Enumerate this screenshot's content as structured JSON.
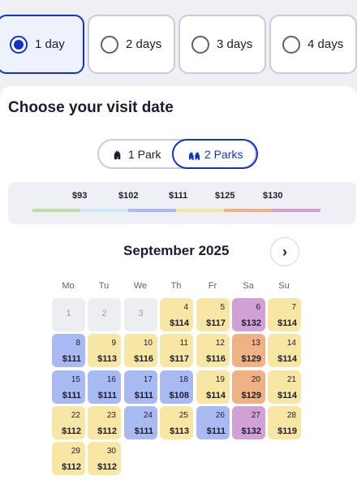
{
  "durations": [
    {
      "label": "1 day",
      "selected": true
    },
    {
      "label": "2 days",
      "selected": false
    },
    {
      "label": "3 days",
      "selected": false
    },
    {
      "label": "4 days",
      "selected": false
    }
  ],
  "section_title": "Choose your visit date",
  "park_toggle": [
    {
      "label": "1 Park",
      "selected": false,
      "icon": "castle-icon"
    },
    {
      "label": "2 Parks",
      "selected": true,
      "icon": "castles-icon"
    }
  ],
  "legend": [
    {
      "price": "$93",
      "color": "#b9e0a4"
    },
    {
      "price": "$102",
      "color": "#c9e9f6"
    },
    {
      "price": "$111",
      "color": "#a9baf2"
    },
    {
      "price": "$125",
      "color": "#f8e6a5"
    },
    {
      "price": "$130",
      "color": "#f0b282"
    },
    {
      "price": "",
      "color": "#d1a1d6"
    }
  ],
  "calendar": {
    "month": "September 2025",
    "weekdays": [
      "Mo",
      "Tu",
      "We",
      "Th",
      "Fr",
      "Sa",
      "Su"
    ],
    "tiers": {
      "blue": "#a9baf2",
      "yellow": "#f8e6a5",
      "orange": "#f0b282",
      "purple": "#d1a1d6"
    },
    "days": [
      {
        "day": "1",
        "price": "",
        "tier": "na"
      },
      {
        "day": "2",
        "price": "",
        "tier": "na"
      },
      {
        "day": "3",
        "price": "",
        "tier": "na"
      },
      {
        "day": "4",
        "price": "$114",
        "tier": "yellow"
      },
      {
        "day": "5",
        "price": "$117",
        "tier": "yellow"
      },
      {
        "day": "6",
        "price": "$132",
        "tier": "purple"
      },
      {
        "day": "7",
        "price": "$114",
        "tier": "yellow"
      },
      {
        "day": "8",
        "price": "$111",
        "tier": "blue"
      },
      {
        "day": "9",
        "price": "$113",
        "tier": "yellow"
      },
      {
        "day": "10",
        "price": "$116",
        "tier": "yellow"
      },
      {
        "day": "11",
        "price": "$117",
        "tier": "yellow"
      },
      {
        "day": "12",
        "price": "$116",
        "tier": "yellow"
      },
      {
        "day": "13",
        "price": "$129",
        "tier": "orange"
      },
      {
        "day": "14",
        "price": "$114",
        "tier": "yellow"
      },
      {
        "day": "15",
        "price": "$111",
        "tier": "blue"
      },
      {
        "day": "16",
        "price": "$111",
        "tier": "blue"
      },
      {
        "day": "17",
        "price": "$111",
        "tier": "blue"
      },
      {
        "day": "18",
        "price": "$108",
        "tier": "blue"
      },
      {
        "day": "19",
        "price": "$114",
        "tier": "yellow"
      },
      {
        "day": "20",
        "price": "$129",
        "tier": "orange"
      },
      {
        "day": "21",
        "price": "$114",
        "tier": "yellow"
      },
      {
        "day": "22",
        "price": "$112",
        "tier": "yellow"
      },
      {
        "day": "23",
        "price": "$112",
        "tier": "yellow"
      },
      {
        "day": "24",
        "price": "$111",
        "tier": "blue"
      },
      {
        "day": "25",
        "price": "$113",
        "tier": "yellow"
      },
      {
        "day": "26",
        "price": "$111",
        "tier": "blue"
      },
      {
        "day": "27",
        "price": "$132",
        "tier": "purple"
      },
      {
        "day": "28",
        "price": "$119",
        "tier": "yellow"
      },
      {
        "day": "29",
        "price": "$112",
        "tier": "yellow"
      },
      {
        "day": "30",
        "price": "$112",
        "tier": "yellow"
      }
    ]
  }
}
